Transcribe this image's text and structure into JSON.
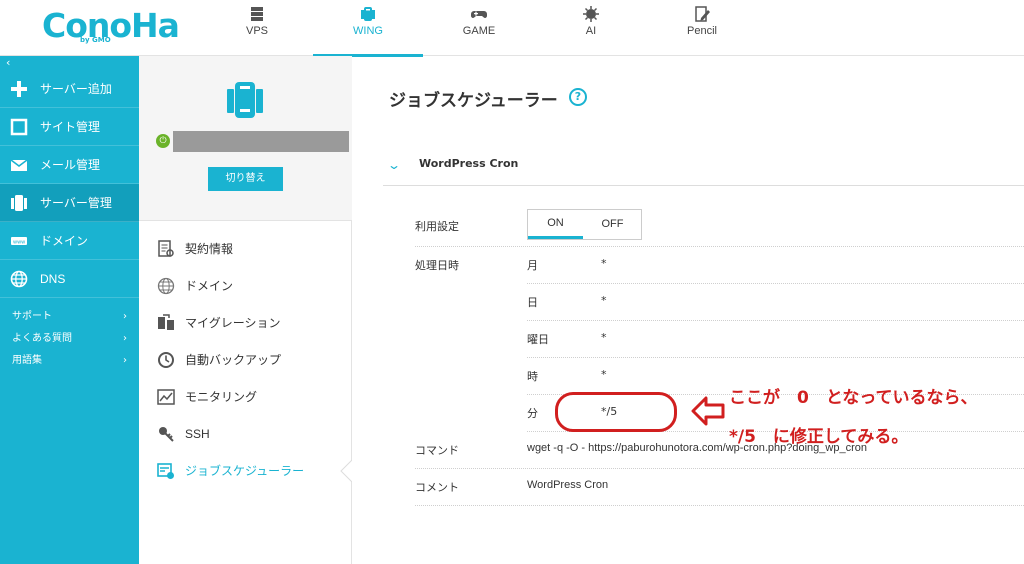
{
  "header": {
    "logo_text": "ConoHa",
    "logo_by": "by GMO",
    "tabs": [
      {
        "label": "VPS",
        "icon": "server-stack-icon",
        "active": false
      },
      {
        "label": "WING",
        "icon": "wing-server-icon",
        "active": true
      },
      {
        "label": "GAME",
        "icon": "gamepad-icon",
        "active": false
      },
      {
        "label": "AI",
        "icon": "ai-chip-icon",
        "active": false
      },
      {
        "label": "Pencil",
        "icon": "pencil-doc-icon",
        "active": false
      }
    ]
  },
  "sidebar": {
    "collapse_glyph": "‹",
    "items": [
      {
        "label": "サーバー追加",
        "icon": "plus-icon"
      },
      {
        "label": "サイト管理",
        "icon": "window-icon"
      },
      {
        "label": "メール管理",
        "icon": "mail-icon"
      },
      {
        "label": "サーバー管理",
        "icon": "server-icon",
        "active": true
      },
      {
        "label": "ドメイン",
        "icon": "domain-icon"
      },
      {
        "label": "DNS",
        "icon": "globe-icon"
      }
    ],
    "links": [
      {
        "label": "サポート",
        "chevron": "›"
      },
      {
        "label": "よくある質問",
        "chevron": "›"
      },
      {
        "label": "用語集",
        "chevron": "›"
      }
    ]
  },
  "server_panel": {
    "power_glyph": "⏻",
    "switch_label": "切り替え",
    "menu": [
      {
        "label": "契約情報",
        "icon": "contract-doc-icon"
      },
      {
        "label": "ドメイン",
        "icon": "globe-icon"
      },
      {
        "label": "マイグレーション",
        "icon": "migration-icon"
      },
      {
        "label": "自動バックアップ",
        "icon": "backup-clock-icon"
      },
      {
        "label": "モニタリング",
        "icon": "monitoring-chart-icon"
      },
      {
        "label": "SSH",
        "icon": "key-icon"
      },
      {
        "label": "ジョブスケジューラー",
        "icon": "scheduler-icon",
        "active": true
      }
    ]
  },
  "main": {
    "title": "ジョブスケジューラー",
    "help_glyph": "?",
    "section_title": "WordPress Cron",
    "section_chevron": "⌄",
    "usage_label": "利用設定",
    "toggle_on": "ON",
    "toggle_off": "OFF",
    "schedule_label": "処理日時",
    "schedule": [
      {
        "unit": "月",
        "value": "*"
      },
      {
        "unit": "日",
        "value": "*"
      },
      {
        "unit": "曜日",
        "value": "*"
      },
      {
        "unit": "時",
        "value": "*"
      },
      {
        "unit": "分",
        "value": "*/5"
      }
    ],
    "command_label": "コマンド",
    "command_value": "wget -q -O - https://paburohunotora.com/wp-cron.php?doing_wp_cron",
    "comment_label": "コメント",
    "comment_value": "WordPress Cron"
  },
  "annotation": {
    "line1": "ここが　0　となっているなら、",
    "line2": "*/5　に修正してみる。",
    "color": "#d11f1f"
  },
  "colors": {
    "accent": "#1ab3d1",
    "sidebar_active": "#129fbc",
    "power": "#6bb32a"
  }
}
